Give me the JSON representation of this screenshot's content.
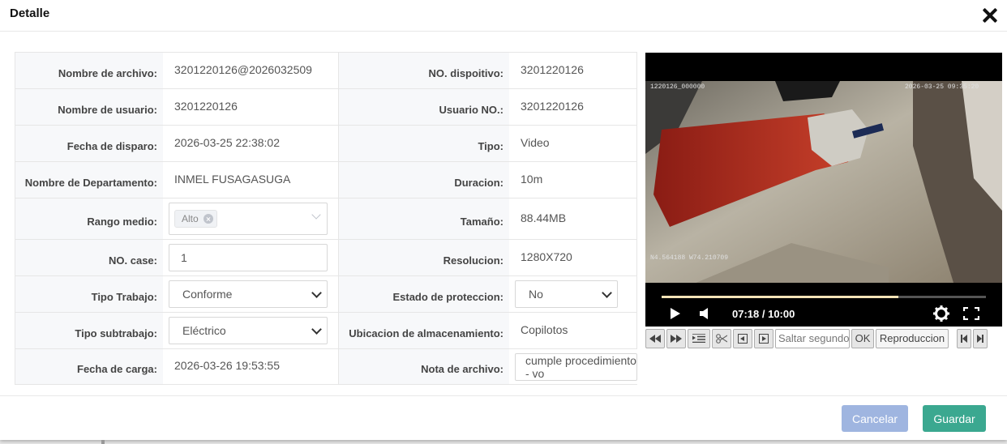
{
  "dialog": {
    "title": "Detalle"
  },
  "fields": {
    "nombre_archivo": {
      "label": "Nombre de archivo:",
      "value": "3201220126@2026032509"
    },
    "no_dispositivo": {
      "label": "NO. dispoitivo:",
      "value": "3201220126"
    },
    "nombre_usuario": {
      "label": "Nombre de usuario:",
      "value": "3201220126"
    },
    "usuario_no": {
      "label": "Usuario NO.:",
      "value": "3201220126"
    },
    "fecha_disparo": {
      "label": "Fecha de disparo:",
      "value": "2026-03-25 22:38:02"
    },
    "tipo": {
      "label": "Tipo:",
      "value": "Video"
    },
    "departamento": {
      "label": "Nombre de Departamento:",
      "value": "INMEL FUSAGASUGA"
    },
    "duracion": {
      "label": "Duracion:",
      "value": "10m"
    },
    "rango_medio": {
      "label": "Rango medio:",
      "tag": "Alto"
    },
    "tamano": {
      "label": "Tamaño:",
      "value": "88.44MB"
    },
    "no_case": {
      "label": "NO. case:",
      "value": "1"
    },
    "resolucion": {
      "label": "Resolucion:",
      "value": "1280X720"
    },
    "tipo_trabajo": {
      "label": "Tipo Trabajo:",
      "value": "Conforme"
    },
    "estado_proteccion": {
      "label": "Estado de proteccion:",
      "value": "No"
    },
    "tipo_subtrabajo": {
      "label": "Tipo subtrabajo:",
      "value": "Eléctrico"
    },
    "ubicacion": {
      "label": "Ubicacion de almacenamiento:",
      "value": "Copilotos"
    },
    "fecha_carga": {
      "label": "Fecha de carga:",
      "value": "2026-03-26 19:53:55"
    },
    "nota_archivo": {
      "label": "Nota de archivo:",
      "value": "cumple procedimiento - vo"
    }
  },
  "player": {
    "overlay_id": "1220126_000000",
    "overlay_time": "2026-03-25 09:35:20",
    "overlay_gps": "N4.564188 W74.210709",
    "time_display": "07:18 / 10:00",
    "progress": 0.73,
    "skip_placeholder": "Saltar segundo",
    "ok_label": "OK",
    "playback_label": "Reproduccion",
    "icons": [
      "play-icon",
      "volume-icon",
      "gear-icon",
      "fullscreen-icon",
      "rewind-icon",
      "fast-forward-icon",
      "list-icon",
      "scissors-icon",
      "frame-back-icon",
      "frame-forward-icon",
      "skip-start-icon",
      "skip-end-icon"
    ]
  },
  "footer": {
    "cancel_label": "Cancelar",
    "save_label": "Guardar"
  },
  "colors": {
    "cancel": "#9fb5e0",
    "save": "#3ba890",
    "progress": "#f3e3b6"
  }
}
